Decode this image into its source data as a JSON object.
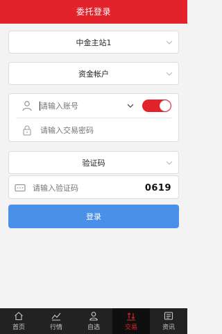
{
  "header": {
    "title": "委托登录"
  },
  "server_select": {
    "value": "中金主站1",
    "chevron_icon": "chevron-down-icon"
  },
  "account_type_select": {
    "value": "资金帐户",
    "chevron_icon": "chevron-down-icon"
  },
  "credentials": {
    "account": {
      "icon": "user-icon",
      "placeholder": "请输入账号",
      "dropdown_icon": "chevron-down-icon"
    },
    "remember_toggle": {
      "state": "on",
      "color": "#e3232c"
    },
    "password": {
      "icon": "lock-icon",
      "placeholder": "请输入交易密码"
    }
  },
  "verify_select": {
    "value": "验证码",
    "chevron_icon": "chevron-down-icon"
  },
  "captcha": {
    "icon": "keyboard-icon",
    "placeholder": "请输入验证码",
    "code": "0619"
  },
  "login_button": {
    "label": "登录",
    "color": "#4a90e8"
  },
  "tabbar": {
    "items": [
      {
        "label": "首页",
        "icon": "home-icon"
      },
      {
        "label": "行情",
        "icon": "chart-icon"
      },
      {
        "label": "自选",
        "icon": "person-icon"
      },
      {
        "label": "交易",
        "icon": "trade-icon",
        "active": true
      },
      {
        "label": "资讯",
        "icon": "news-icon"
      }
    ]
  },
  "colors": {
    "brand_red": "#e3232c",
    "background": "#f3f3f3",
    "tabbar": "#222222"
  }
}
